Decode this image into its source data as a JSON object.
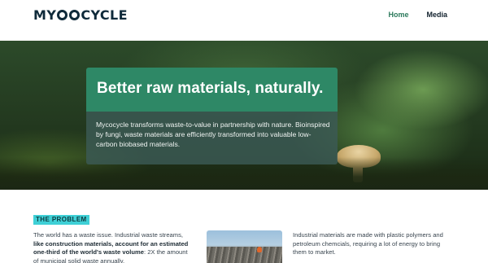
{
  "header": {
    "logo_text_left": "MY",
    "logo_text_right": "CYCLE",
    "nav": [
      {
        "label": "Home",
        "active": true
      },
      {
        "label": "Media",
        "active": false
      }
    ]
  },
  "hero": {
    "title": "Better raw materials, naturally.",
    "description": "Mycocycle transforms waste-to-value in partnership with nature. Bioinspired by fungi, waste materials are efficiently transformed into valuable low-carbon biobased materials."
  },
  "problem": {
    "tag": "THE PROBLEM",
    "text_start": "The world has a waste issue. Industrial waste streams,",
    "text_bold": "like construction materials, account for an estimated one-third of the world's waste volume",
    "text_end": ": 2X the amount of municipal solid waste annually.",
    "right_text": "Industrial materials are made with plastic polymers and petroleum chemcials, requiring a lot of energy to bring them to market."
  },
  "colors": {
    "brand_green": "#2e8866",
    "accent_cyan": "#3fd0d6",
    "nav_active": "#2c7a5c"
  }
}
